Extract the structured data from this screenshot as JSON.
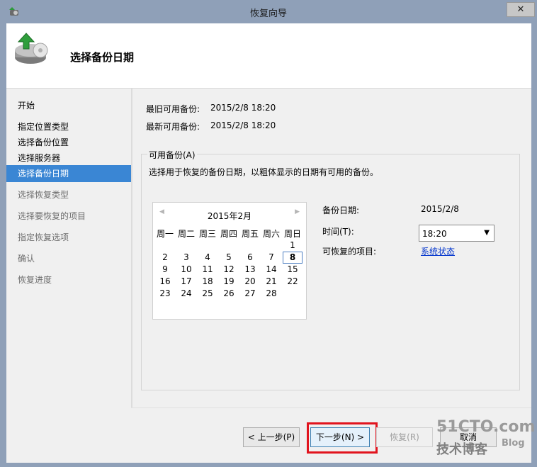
{
  "window": {
    "title": "恢复向导",
    "close_glyph": "✕"
  },
  "header": {
    "title": "选择备份日期"
  },
  "nav": {
    "items": [
      {
        "label": "开始",
        "state": "done"
      },
      {
        "label": "指定位置类型",
        "state": "done"
      },
      {
        "label": "选择备份位置",
        "state": "done"
      },
      {
        "label": "选择服务器",
        "state": "done"
      },
      {
        "label": "选择备份日期",
        "state": "selected"
      },
      {
        "label": "选择恢复类型",
        "state": "pending"
      },
      {
        "label": "选择要恢复的项目",
        "state": "pending"
      },
      {
        "label": "指定恢复选项",
        "state": "pending"
      },
      {
        "label": "确认",
        "state": "pending"
      },
      {
        "label": "恢复进度",
        "state": "pending"
      }
    ]
  },
  "main": {
    "oldest_label": "最旧可用备份:",
    "oldest_value": "2015/2/8 18:20",
    "newest_label": "最新可用备份:",
    "newest_value": "2015/2/8 18:20",
    "group_label": "可用备份(A)",
    "group_desc": "选择用于恢复的备份日期，以粗体显示的日期有可用的备份。",
    "calendar": {
      "month_label": "2015年2月",
      "weekdays": [
        "周一",
        "周二",
        "周三",
        "周四",
        "周五",
        "周六",
        "周日"
      ],
      "weeks": [
        [
          "",
          "",
          "",
          "",
          "",
          "",
          "1"
        ],
        [
          "2",
          "3",
          "4",
          "5",
          "6",
          "7",
          "8"
        ],
        [
          "9",
          "10",
          "11",
          "12",
          "13",
          "14",
          "15"
        ],
        [
          "16",
          "17",
          "18",
          "19",
          "20",
          "21",
          "22"
        ],
        [
          "23",
          "24",
          "25",
          "26",
          "27",
          "28",
          ""
        ]
      ],
      "selected_date": "8",
      "bold_dates": [
        "8"
      ]
    },
    "backup_date_label": "备份日期:",
    "backup_date_value": "2015/2/8",
    "time_label": "时间(T):",
    "time_value": "18:20",
    "recoverable_label": "可恢复的项目:",
    "recoverable_link": "系统状态"
  },
  "footer": {
    "prev_label": "< 上一步(P)",
    "next_label": "下一步(N) >",
    "recover_label": "恢复(R)",
    "cancel_label": "取消"
  },
  "watermark": {
    "line1": "51CTO.com",
    "line2": "技术博客",
    "line3": "Blog"
  },
  "colors": {
    "selection": "#3a86d4",
    "highlight_box": "#e1141e",
    "link": "#0033cc"
  }
}
